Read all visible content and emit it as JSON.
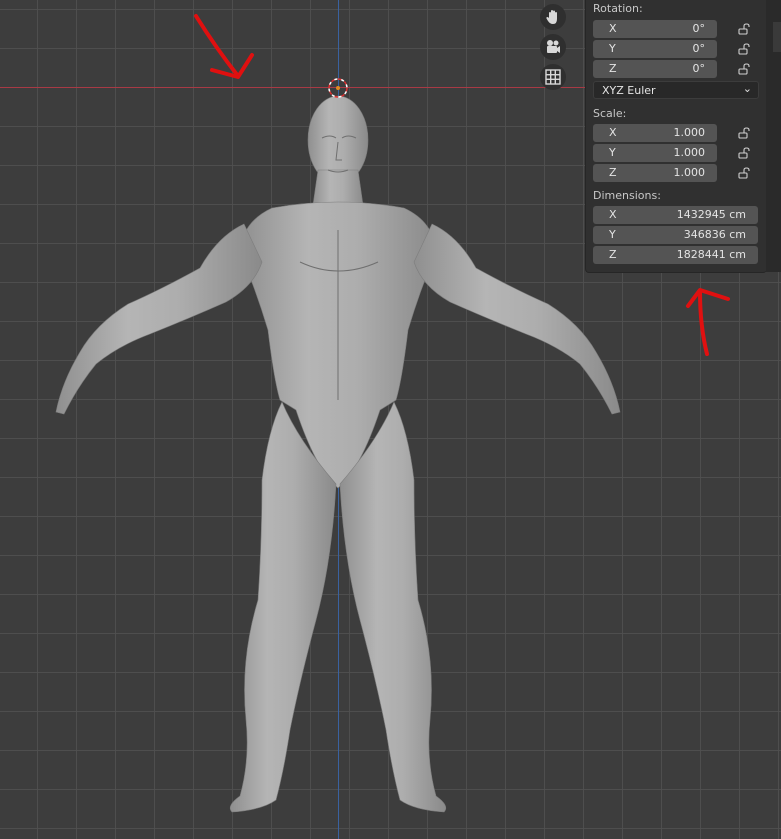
{
  "viewport": {
    "grid": true,
    "x_axis_color": "#a83a45",
    "z_axis_color": "#3a62a0",
    "annotation_color": "#e01010"
  },
  "navigation_gizmo": {
    "icons": [
      "hand-pan-icon",
      "camera-icon",
      "grid-view-icon"
    ]
  },
  "npanel": {
    "rotation": {
      "label": "Rotation:",
      "x": {
        "axis": "X",
        "value": "0°"
      },
      "y": {
        "axis": "Y",
        "value": "0°"
      },
      "z": {
        "axis": "Z",
        "value": "0°"
      },
      "mode": "XYZ Euler"
    },
    "scale": {
      "label": "Scale:",
      "x": {
        "axis": "X",
        "value": "1.000"
      },
      "y": {
        "axis": "Y",
        "value": "1.000"
      },
      "z": {
        "axis": "Z",
        "value": "1.000"
      }
    },
    "dimensions": {
      "label": "Dimensions:",
      "x": {
        "axis": "X",
        "value": "1432945 cm"
      },
      "y": {
        "axis": "Y",
        "value": "346836 cm"
      },
      "z": {
        "axis": "Z",
        "value": "1828441 cm"
      }
    }
  }
}
